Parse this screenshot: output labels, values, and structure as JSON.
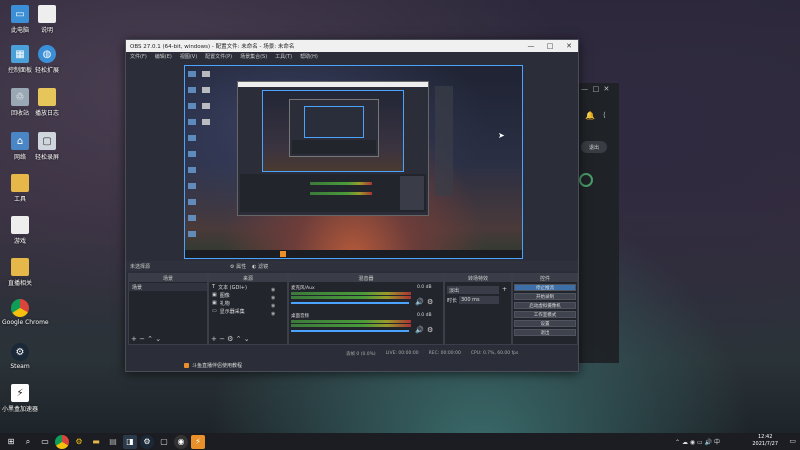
{
  "desktop": {
    "icons": [
      {
        "label": "此电脑",
        "icon": "computer-icon",
        "color": "#3b8fd6"
      },
      {
        "label": "控制面板",
        "icon": "control-panel-icon",
        "color": "#4aa0d8"
      },
      {
        "label": "回收站",
        "icon": "recycle-bin-icon",
        "color": "#9aa7b5"
      },
      {
        "label": "网络",
        "icon": "network-icon",
        "color": "#4a86c5"
      },
      {
        "label": "工具",
        "icon": "folder-icon",
        "color": "#e6b84a"
      },
      {
        "label": "游戏",
        "icon": "file-icon",
        "color": "#eeeeee"
      },
      {
        "label": "直播相关",
        "icon": "folder-icon",
        "color": "#e6b84a"
      },
      {
        "label": "Google Chrome",
        "icon": "chrome-icon",
        "color": "#d9453a"
      },
      {
        "label": "Steam",
        "icon": "steam-icon",
        "color": "#1b2838"
      },
      {
        "label": "小黑盒加速器",
        "icon": "accelerator-icon",
        "color": "#ffffff"
      }
    ],
    "icons2": [
      {
        "label": "说明",
        "icon": "document-icon",
        "color": "#eeeeee"
      },
      {
        "label": "轻松扩展",
        "icon": "globe-icon",
        "color": "#3b8fd6"
      },
      {
        "label": "播放日志",
        "icon": "document-icon",
        "color": "#e6c65a"
      },
      {
        "label": "轻松录屏",
        "icon": "monitor-icon",
        "color": "#cfd6dd"
      }
    ]
  },
  "obs": {
    "title": "OBS 27.0.1 (64-bit, windows) - 配置文件: 未命名 - 场景: 未命名",
    "menu": [
      "文件(F)",
      "编辑(E)",
      "视图(V)",
      "配置文件(P)",
      "场景集合(S)",
      "工具(T)",
      "帮助(H)"
    ],
    "source_toolbar": {
      "properties": "属性",
      "filters": "滤镜",
      "no_source": "未选择源"
    },
    "docks": {
      "scenes": "场景",
      "sources": "来源",
      "mixer": "混音器",
      "transitions": "转场特效",
      "controls": "控件"
    },
    "scene_items": [
      "场景"
    ],
    "source_items": [
      "文本 (GDI+)",
      "图像",
      "礼物",
      "显示器采集"
    ],
    "mixer_tracks": [
      {
        "name": "麦克风/Aux",
        "db": "0.0 dB"
      },
      {
        "name": "桌面音频",
        "db": "0.0 dB"
      }
    ],
    "transition": {
      "type": "淡出",
      "duration_label": "时长",
      "duration": "300 ms"
    },
    "controls": [
      "停止推流",
      "开始录制",
      "启动虚拟摄像机",
      "工作室模式",
      "设置",
      "退出"
    ],
    "status": {
      "dropped": "丢帧 0 (0.0%)",
      "live": "LIVE: 00:00:00",
      "rec": "REC: 00:00:00",
      "cpu": "CPU: 0.7%, 60.00 fps"
    },
    "notice": "斗鱼直播伴侣使用教程"
  },
  "right_window": {
    "exit_button": "退出"
  },
  "taskbar": {
    "icons": [
      "start-icon",
      "search-icon",
      "chrome-icon",
      "settings-icon",
      "explorer-icon",
      "store-icon",
      "steam-icon",
      "monitor-icon",
      "obs-icon",
      "douyu-icon"
    ],
    "time": "12:42",
    "date": "2021/7/27"
  },
  "colors": {
    "accent": "#4aa3ff",
    "obs_bg": "#2b2e38",
    "highlight": "#3d6fa8"
  }
}
